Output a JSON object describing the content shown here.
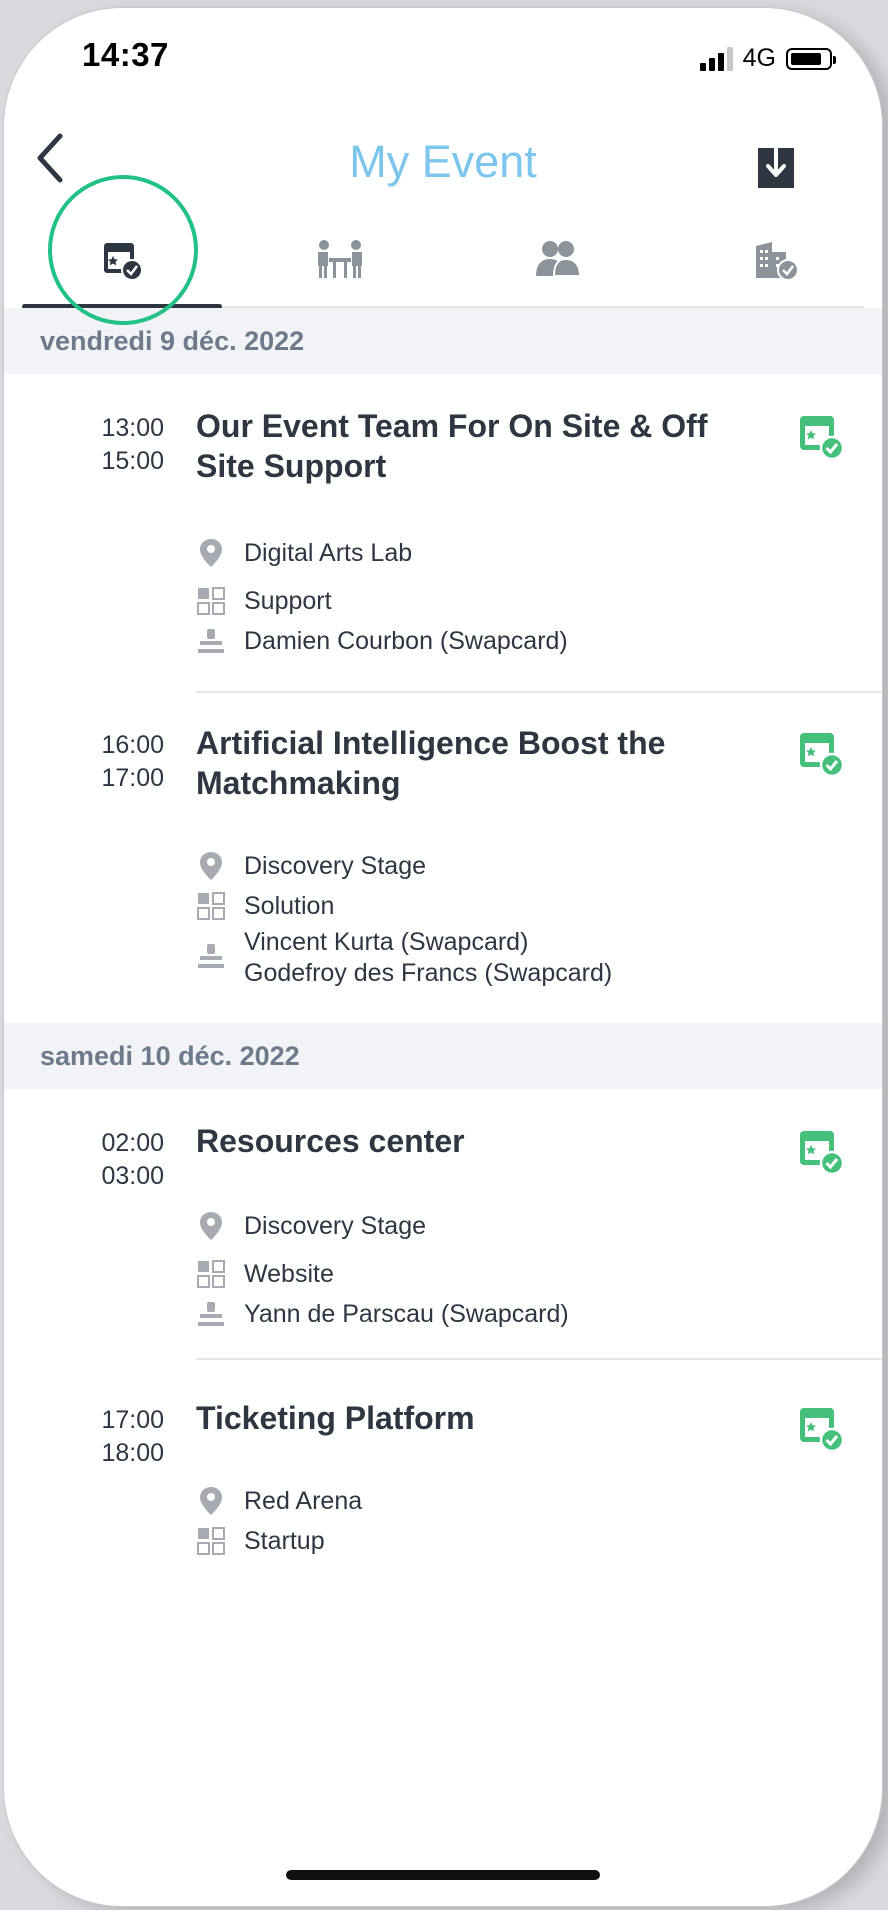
{
  "status": {
    "time": "14:37",
    "network": "4G"
  },
  "header": {
    "title": "My Event"
  },
  "tabs": [
    {
      "icon": "calendar-check-icon",
      "active": true
    },
    {
      "icon": "meeting-table-icon",
      "active": false
    },
    {
      "icon": "people-icon",
      "active": false
    },
    {
      "icon": "building-check-icon",
      "active": false
    }
  ],
  "colors": {
    "accent_title": "#7cc6ee",
    "badge_green": "#44c07a",
    "text_dark": "#2e3642",
    "highlight": "#22c185"
  },
  "days": [
    {
      "label": "vendredi 9 déc. 2022",
      "sessions": [
        {
          "start": "13:00",
          "end": "15:00",
          "title": "Our Event Team For On Site & Off Site Support",
          "location": "Digital Arts Lab",
          "category": "Support",
          "speakers": [
            "Damien Courbon (Swapcard)"
          ]
        },
        {
          "start": "16:00",
          "end": "17:00",
          "title": "Artificial Intelligence Boost the Matchmaking",
          "location": "Discovery Stage",
          "category": "Solution",
          "speakers": [
            "Vincent Kurta (Swapcard)",
            "Godefroy des Francs (Swapcard)"
          ]
        }
      ]
    },
    {
      "label": "samedi 10 déc. 2022",
      "sessions": [
        {
          "start": "02:00",
          "end": "03:00",
          "title": "Resources center",
          "location": "Discovery Stage",
          "category": "Website",
          "speakers": [
            "Yann de Parscau (Swapcard)"
          ]
        },
        {
          "start": "17:00",
          "end": "18:00",
          "title": "Ticketing Platform",
          "location": "Red Arena",
          "category": "Startup",
          "speakers": []
        }
      ]
    }
  ]
}
